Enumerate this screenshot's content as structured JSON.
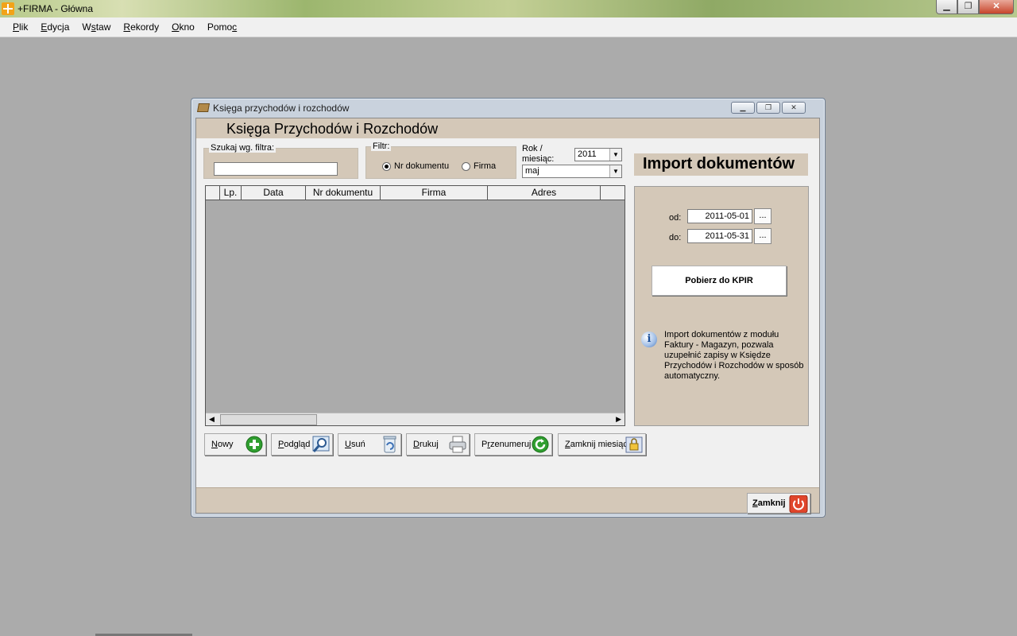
{
  "app": {
    "title": "+FIRMA - Główna"
  },
  "menu": [
    {
      "pre": "",
      "acc": "P",
      "post": "lik"
    },
    {
      "pre": "",
      "acc": "E",
      "post": "dycja"
    },
    {
      "pre": "W",
      "acc": "s",
      "post": "taw"
    },
    {
      "pre": "",
      "acc": "R",
      "post": "ekordy"
    },
    {
      "pre": "",
      "acc": "O",
      "post": "kno"
    },
    {
      "pre": "Pomo",
      "acc": "c",
      "post": ""
    }
  ],
  "window": {
    "title": "Księga przychodów i rozchodów",
    "header": "Księga Przychodów i Rozchodów"
  },
  "search": {
    "legend": "Szukaj wg. filtra:",
    "value": ""
  },
  "filter": {
    "legend": "Filtr:",
    "opt1": "Nr dokumentu",
    "opt2": "Firma"
  },
  "period": {
    "label1": "Rok  /",
    "label2": "miesiąc:",
    "year": "2011",
    "month": "maj"
  },
  "grid": {
    "columns": [
      "",
      "Lp.",
      "Data",
      "Nr dokumentu",
      "Firma",
      "Adres",
      ""
    ]
  },
  "import": {
    "title": "Import dokumentów",
    "from_label": "od:",
    "from_value": "2011-05-01",
    "to_label": "do:",
    "to_value": "2011-05-31",
    "dots": "...",
    "fetch_label": "Pobierz do KPIR",
    "info": "Import dokumentów z modułu Faktury - Magazyn, pozwala uzupełnić zapisy w Księdze Przychodów  i Rozchodów w sposób automatyczny."
  },
  "toolbar": {
    "new": {
      "acc": "N",
      "rest": "owy"
    },
    "preview": {
      "acc": "P",
      "rest": "odgląd"
    },
    "delete": {
      "acc": "U",
      "rest": "suń"
    },
    "print": {
      "acc": "D",
      "rest": "rukuj"
    },
    "renumber": {
      "pre": "P",
      "acc": "r",
      "rest": "zenumeruj"
    },
    "close_month": {
      "acc": "Z",
      "rest": "amknij miesiąc"
    }
  },
  "footer": {
    "close": {
      "acc": "Z",
      "rest": "amknij"
    }
  },
  "colors": {
    "panel": "#d4c8b8",
    "desktop": "#ababab"
  }
}
